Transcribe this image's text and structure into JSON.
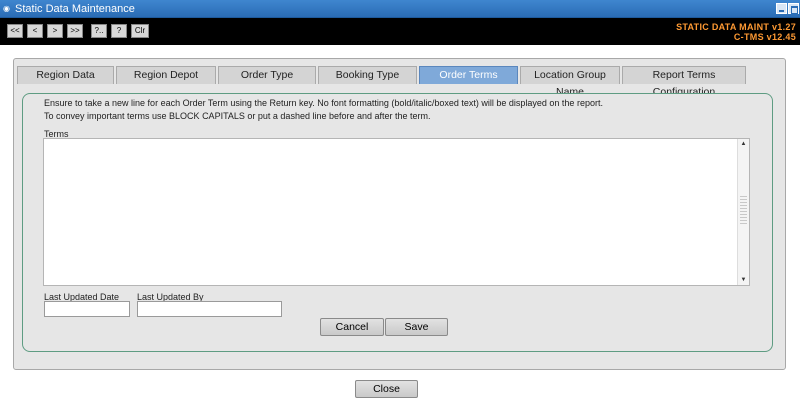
{
  "window": {
    "title": "Static Data Maintenance",
    "icon": "app-icon"
  },
  "toolbar": {
    "buttons": [
      "<<",
      "<",
      ">",
      ">>",
      "?..",
      "?",
      "Clr"
    ],
    "version_line1": "STATIC DATA MAINT v1.27",
    "version_line2": "C-TMS v12.45"
  },
  "tabs": [
    "Region Data",
    "Region Depot",
    "Order Type",
    "Booking Type",
    "Order Terms",
    "Location Group Name",
    "Report Terms Configuration"
  ],
  "active_tab": "Order Terms",
  "instructions": {
    "line1": "Ensure to take a new line for each Order Term using the Return key. No font formatting (bold/italic/boxed text) will be displayed on the report.",
    "line2": "To convey important terms use BLOCK CAPITALS or put a dashed line before and after the term."
  },
  "terms": {
    "label": "Terms",
    "value": ""
  },
  "last_updated_date": {
    "label": "Last Updated Date",
    "value": ""
  },
  "last_updated_by": {
    "label": "Last Updated By",
    "value": ""
  },
  "actions": {
    "cancel": "Cancel",
    "save": "Save",
    "close": "Close"
  },
  "colors": {
    "accent": "#7fa9d9",
    "version_text": "#ff9a33",
    "title_bar": "#2a6cb5",
    "panel_border": "#5e9c82"
  }
}
